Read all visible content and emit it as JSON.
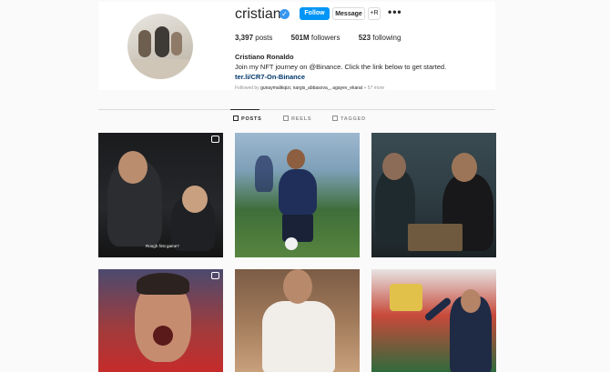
{
  "profile": {
    "username": "cristiano",
    "verified_icon": "verified-badge-icon",
    "buttons": {
      "follow": "Follow",
      "message": "Message",
      "suggest": "+R",
      "more": "•••"
    },
    "stats": {
      "posts": "3,397",
      "posts_label": "posts",
      "followers": "501M",
      "followers_label": "followers",
      "following": "523",
      "following_label": "following"
    },
    "full_name": "Cristiano Ronaldo",
    "bio": "Join my NFT journey on @Binance. Click the link below to get started.",
    "link": "ter.li/CR7-On-Binance",
    "followed_by_prefix": "Followed by",
    "followed_by_names": "gunaymalikqizi, nargis_abbasova_, agayev_ekarat",
    "followed_by_suffix": "+ 57 more"
  },
  "tabs": [
    {
      "label": "POSTS",
      "active": true
    },
    {
      "label": "REELS",
      "active": false
    },
    {
      "label": "TAGGED",
      "active": false
    }
  ],
  "posts": [
    {
      "caption": "Rough first game?",
      "type": "reel"
    },
    {
      "type": "photo"
    },
    {
      "type": "photo"
    },
    {
      "type": "reel"
    },
    {
      "type": "photo"
    },
    {
      "type": "photo"
    }
  ],
  "colors": {
    "accent": "#0095f6",
    "background": "#fafafa",
    "link": "#00376b"
  }
}
